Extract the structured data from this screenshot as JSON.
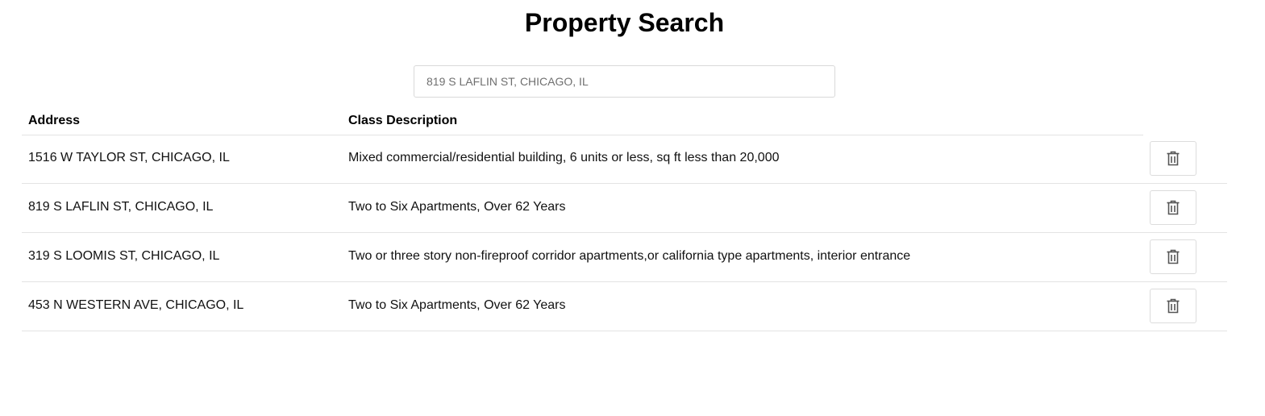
{
  "page": {
    "title": "Property Search"
  },
  "search": {
    "placeholder": "819 S LAFLIN ST, CHICAGO, IL",
    "value": ""
  },
  "table": {
    "columns": [
      "Address",
      "Class Description"
    ],
    "rows": [
      {
        "address": "1516 W TAYLOR ST, CHICAGO, IL",
        "class_description": "Mixed commercial/residential building, 6 units or less, sq ft less than 20,000",
        "action_icon": "trash-icon"
      },
      {
        "address": "819 S LAFLIN ST, CHICAGO, IL",
        "class_description": "Two to Six Apartments, Over 62 Years",
        "action_icon": "trash-icon"
      },
      {
        "address": "319 S LOOMIS ST, CHICAGO, IL",
        "class_description": "Two or three story non-fireproof corridor apartments,or california type apartments, interior entrance",
        "action_icon": "trash-icon"
      },
      {
        "address": "453 N WESTERN AVE, CHICAGO, IL",
        "class_description": "Two to Six Apartments, Over 62 Years",
        "action_icon": "trash-icon"
      }
    ]
  },
  "colors": {
    "icon": "#555555",
    "border": "#e3e3e3"
  }
}
